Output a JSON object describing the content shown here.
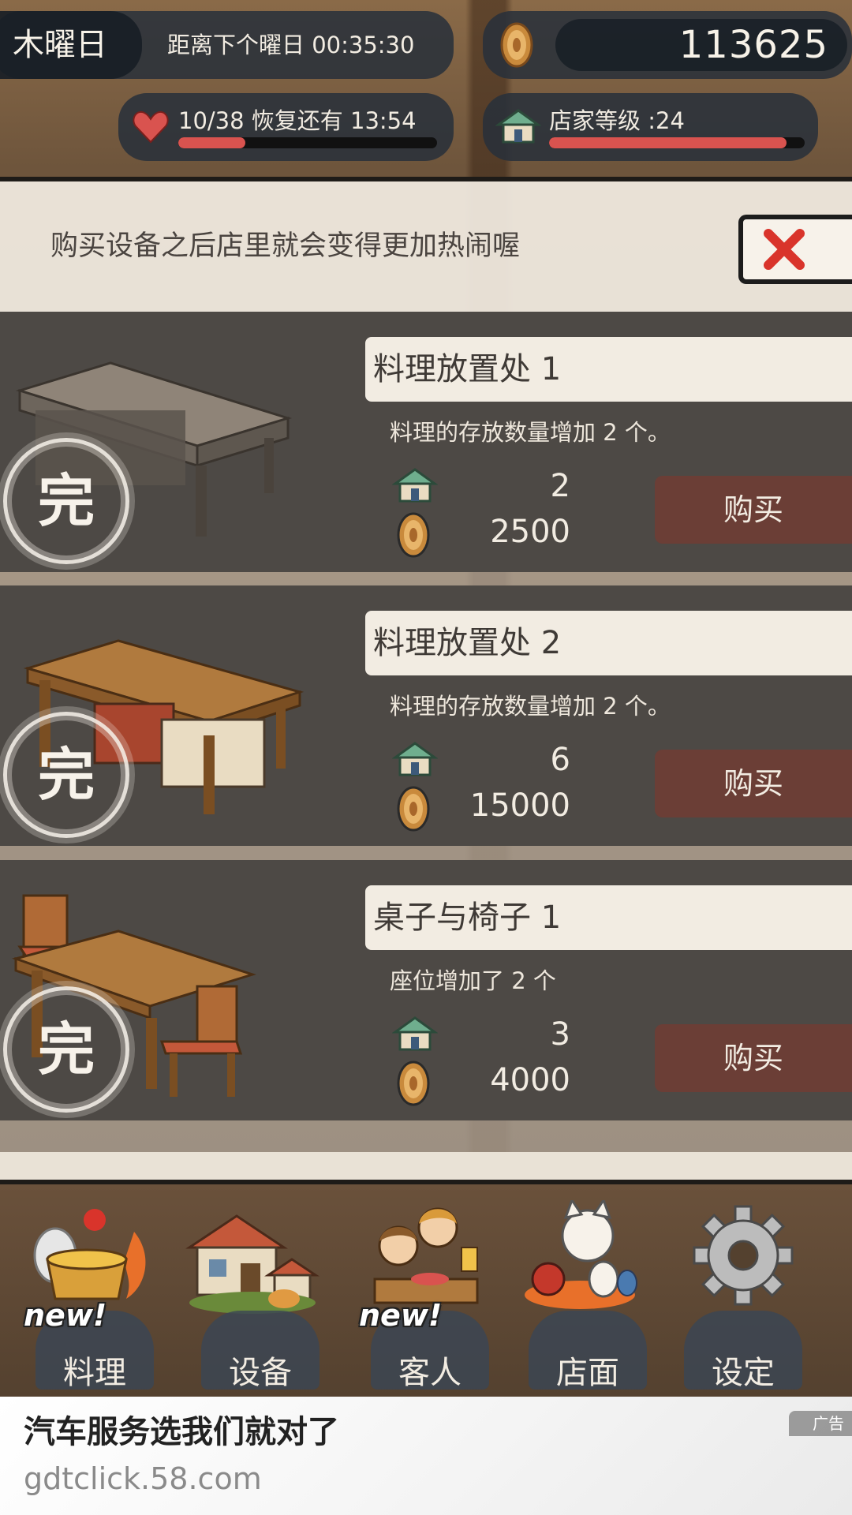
{
  "hud": {
    "weekday": "木曜日",
    "countdown_text": "距离下个曜日 00:35:30",
    "coins": "113625",
    "stamina_text": "10/38  恢复还有  13:54",
    "stamina_fraction": 0.26,
    "shop_level_text": "店家等级 :24",
    "shop_level_fraction": 0.93
  },
  "dialog": {
    "message": "购买设备之后店里就会变得更加热闹喔",
    "close_icon": "close-x-icon"
  },
  "items": [
    {
      "title": "料理放置处 1",
      "description": "料理的存放数量增加 2 个。",
      "stamp": "完",
      "shop_level": "2",
      "price": "2500",
      "buy_label": "购买"
    },
    {
      "title": "料理放置处 2",
      "description": "料理的存放数量增加 2 个。",
      "stamp": "完",
      "shop_level": "6",
      "price": "15000",
      "buy_label": "购买"
    },
    {
      "title": "桌子与椅子 1",
      "description": "座位增加了 2 个",
      "stamp": "完",
      "shop_level": "3",
      "price": "4000",
      "buy_label": "购买"
    }
  ],
  "nav": [
    {
      "label": "料理",
      "badge": "new!",
      "icon": "cooking-pot-icon"
    },
    {
      "label": "设备",
      "badge": "",
      "icon": "shop-building-icon"
    },
    {
      "label": "客人",
      "badge": "new!",
      "icon": "customers-icon"
    },
    {
      "label": "店面",
      "badge": "",
      "icon": "lucky-cat-icon"
    },
    {
      "label": "设定",
      "badge": "",
      "icon": "gear-icon"
    }
  ],
  "ad": {
    "title": "汽车服务选我们就对了",
    "url": "gdtclick.58.com",
    "badge": "广告"
  },
  "colors": {
    "panel": "#4d4945",
    "buy_button": "#6b3e36",
    "bar_fill": "#d9534f",
    "hud_pill": "#28303a"
  }
}
